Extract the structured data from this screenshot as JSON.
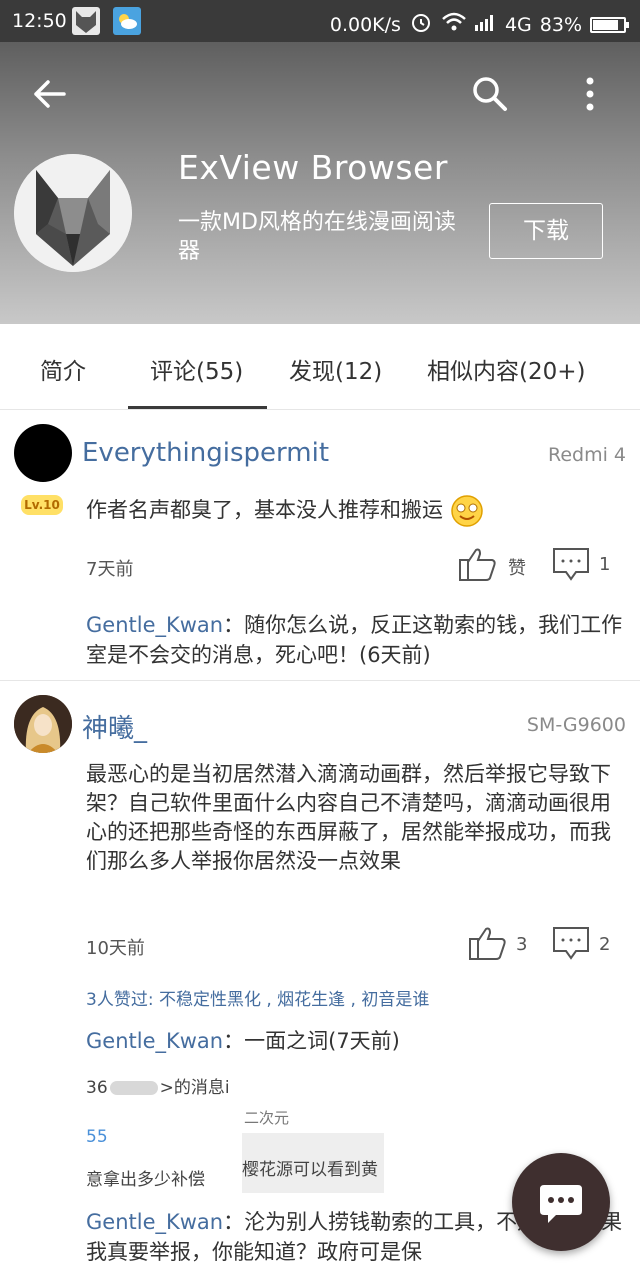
{
  "status_bar": {
    "time": "12:50",
    "network_speed": "0.00K/s",
    "network": "4G",
    "battery": "83%",
    "battery_level": 0.83
  },
  "app": {
    "title": "ExView Browser",
    "description": "一款MD风格的在线漫画阅读器",
    "download_label": "下载"
  },
  "tabs": [
    {
      "label": "简介"
    },
    {
      "label": "评论(55)",
      "active": true
    },
    {
      "label": "发现(12)"
    },
    {
      "label": "相似内容(20+)"
    }
  ],
  "comments": [
    {
      "username": "Everythingispermit",
      "device": "Redmi 4",
      "level": "Lv.10",
      "text": "作者名声都臭了，基本没人推荐和搬运",
      "time": "7天前",
      "like_label": "赞",
      "reply_count": "1",
      "reply_name": "Gentle_Kwan",
      "reply_text": "：随你怎么说，反正这勒索的钱，我们工作室是不会交的消息，死心吧！(6天前)"
    },
    {
      "username": "神曦_",
      "device": "SM-G9600",
      "text": "最恶心的是当初居然潜入滴滴动画群，然后举报它导致下架？自己软件里面什么内容自己不清楚吗，滴滴动画很用心的还把那些奇怪的东西屏蔽了，居然能举报成功，而我们那么多人举报你居然没一点效果",
      "time": "10天前",
      "like_count": "3",
      "reply_count": "2",
      "likers": "3人赞过: 不稳定性黑化 , 烟花生逢 , 初音是谁",
      "reply1_name": "Gentle_Kwan",
      "reply1_text": "：一面之词(7天前)",
      "image_text_1": "36",
      "image_text_2": ">的消息i",
      "image_text_3": "二次元",
      "image_text_4": "55",
      "image_text_5": "意拿出多少补偿",
      "image_text_6": "樱花源可以看到黄",
      "reply2_name": "Gentle_Kwan",
      "reply2_text": "：沦为别人捞钱勒索的工具，不知。。。如果我真要举报，你能知道？政府可是保"
    }
  ],
  "colors": {
    "accent": "#456d9f",
    "fab": "#3f2f2f"
  }
}
